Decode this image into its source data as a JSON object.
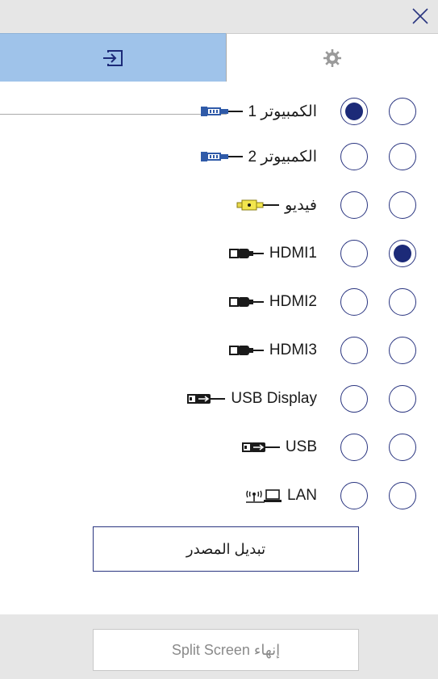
{
  "window": {
    "close_icon": "close-icon"
  },
  "tabs": [
    {
      "name": "input-source-tab",
      "icon": "input-source-icon",
      "active": true
    },
    {
      "name": "settings-tab",
      "icon": "gear-icon",
      "active": false
    }
  ],
  "sources": [
    {
      "label": "الكمبيوتر 1",
      "icon": "vga-connector-icon",
      "col1_selected": true,
      "col2_selected": false
    },
    {
      "label": "الكمبيوتر 2",
      "icon": "vga-connector-icon",
      "col1_selected": false,
      "col2_selected": false
    },
    {
      "label": "فيديو",
      "icon": "composite-video-connector-icon",
      "col1_selected": false,
      "col2_selected": false
    },
    {
      "label": "HDMI1",
      "icon": "hdmi-connector-icon",
      "col1_selected": false,
      "col2_selected": true
    },
    {
      "label": "HDMI2",
      "icon": "hdmi-connector-icon",
      "col1_selected": false,
      "col2_selected": false
    },
    {
      "label": "HDMI3",
      "icon": "hdmi-connector-icon",
      "col1_selected": false,
      "col2_selected": false
    },
    {
      "label": "USB Display",
      "icon": "usb-connector-icon",
      "col1_selected": false,
      "col2_selected": false
    },
    {
      "label": "USB",
      "icon": "usb-connector-icon",
      "col1_selected": false,
      "col2_selected": false
    },
    {
      "label": "LAN",
      "icon": "wireless-lan-icon",
      "col1_selected": false,
      "col2_selected": false
    }
  ],
  "buttons": {
    "switch_source": "تبديل المصدر",
    "end_split_screen": "إنهاء Split Screen"
  },
  "colors": {
    "active_tab": "#9fc3ea",
    "radio_accent": "#1c2a78",
    "panel_gray": "#e6e6e6"
  }
}
